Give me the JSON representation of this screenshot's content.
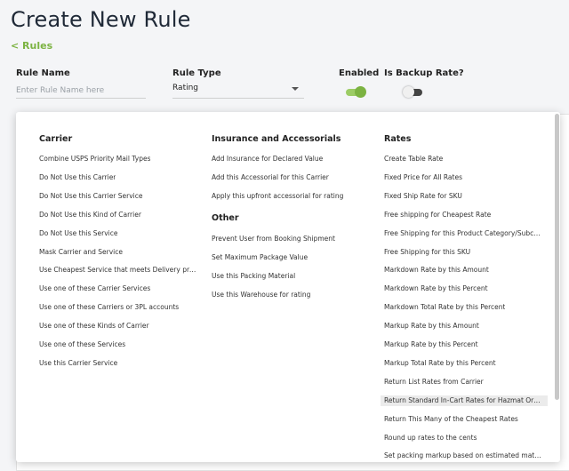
{
  "page": {
    "title": "Create New Rule",
    "back_link": "< Rules"
  },
  "form": {
    "rule_name_label": "Rule Name",
    "rule_name_placeholder": "Enter Rule Name here",
    "rule_type_label": "Rule Type",
    "rule_type_value": "Rating",
    "enabled_label": "Enabled",
    "enabled_state": "on",
    "backup_label": "Is Backup Rate?",
    "backup_state": "off"
  },
  "colors": {
    "accent": "#7cb342",
    "title": "#1f2937"
  },
  "menu": {
    "carrier": {
      "header": "Carrier",
      "items": [
        "Combine USPS Priority Mail Types",
        "Do Not Use this Carrier",
        "Do Not Use this Carrier Service",
        "Do Not Use this Kind of Carrier",
        "Do Not Use this Service",
        "Mask Carrier and Service",
        "Use Cheapest Service that meets Delivery prom…",
        "Use one of these Carrier Services",
        "Use one of these Carriers or 3PL accounts",
        "Use one of these Kinds of Carrier",
        "Use one of these Services",
        "Use this Carrier Service"
      ]
    },
    "insurance": {
      "header": "Insurance and Accessorials",
      "items": [
        "Add Insurance for Declared Value",
        "Add this Accessorial for this Carrier",
        "Apply this upfront accessorial for rating"
      ]
    },
    "other": {
      "header": "Other",
      "items": [
        "Prevent User from Booking Shipment",
        "Set Maximum Package Value",
        "Use this Packing Material",
        "Use this Warehouse for rating"
      ]
    },
    "rates": {
      "header": "Rates",
      "highlighted": "Return Standard In-Cart Rates for Hazmat Orders",
      "items": [
        "Create Table Rate",
        "Fixed Price for All Rates",
        "Fixed Ship Rate for SKU",
        "Free shipping for Cheapest Rate",
        "Free Shipping for this Product Category/Subcat…",
        "Free Shipping for this SKU",
        "Markdown Rate by this Amount",
        "Markdown Rate by this Percent",
        "Markdown Total Rate by this Percent",
        "Markup Rate by this Amount",
        "Markup Rate by this Percent",
        "Markup Total Rate by this Percent",
        "Return List Rates from Carrier",
        "Return Standard In-Cart Rates for Hazmat Orders",
        "Return This Many of the Cheapest Rates",
        "Round up rates to the cents",
        "Set packing markup based on estimated materi…"
      ]
    }
  }
}
